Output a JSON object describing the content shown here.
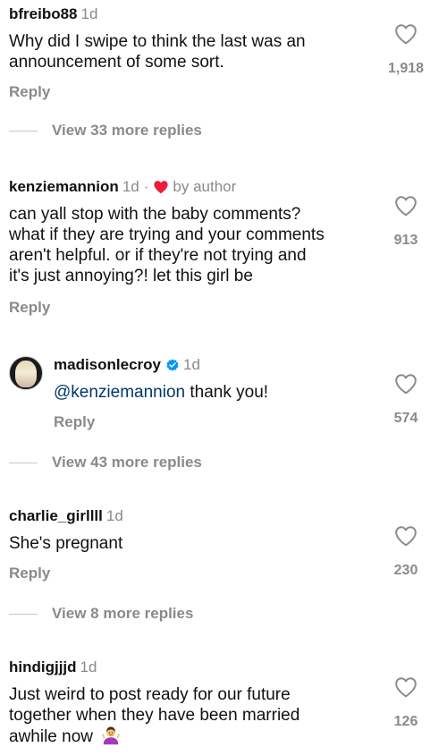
{
  "comments": [
    {
      "username": "bfreibo88",
      "time": "1d",
      "text_lines": [
        "Why did I swipe to think the last was an",
        "announcement of some sort."
      ],
      "reply_label": "Reply",
      "likes": "1,918",
      "view_more": "View 33 more replies"
    },
    {
      "username": "kenziemannion",
      "time": "1d",
      "dot": "·",
      "by_author": "by author",
      "text_lines": [
        "can yall stop with the baby comments?",
        "what if they are trying and your comments",
        "aren't helpful. or if they're not trying and",
        "it's just annoying?! let this girl be"
      ],
      "reply_label": "Reply",
      "likes": "913"
    },
    {
      "username": "madisonlecroy",
      "time": "1d",
      "mention": "@kenziemannion",
      "text_rest": " thank you!",
      "reply_label": "Reply",
      "likes": "574",
      "view_more": "View 43 more replies"
    },
    {
      "username": "charlie_girllll",
      "time": "1d",
      "text_lines": [
        "She's pregnant"
      ],
      "reply_label": "Reply",
      "likes": "230",
      "view_more": "View 8 more replies"
    },
    {
      "username": "hindigjjjd",
      "time": "1d",
      "text_lines": [
        "Just weird to post ready for our future",
        "together when they have been married",
        "awhile now"
      ],
      "emoji": "person-shrugging",
      "likes": "126"
    }
  ],
  "colors": {
    "text": "#111111",
    "muted": "#8a8a8a",
    "mention": "#00376b",
    "heart_red": "#ed1d3a",
    "verified_blue": "#0095f6"
  },
  "icons": [
    "heart-outline-icon",
    "heart-filled-icon",
    "verified-badge-icon",
    "shrug-emoji-icon"
  ]
}
